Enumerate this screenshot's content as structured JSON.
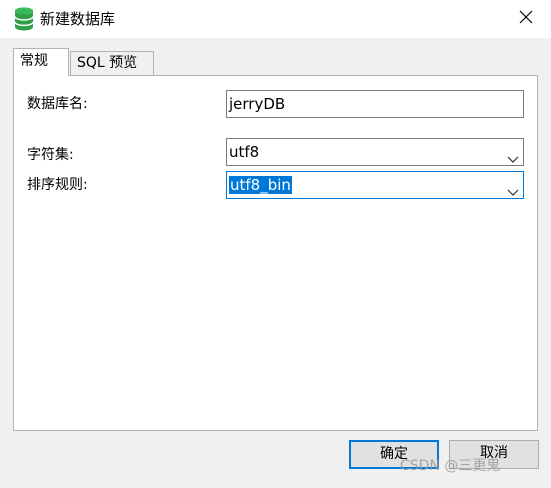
{
  "window": {
    "title": "新建数据库",
    "icon": "database-icon",
    "close_icon": "close-icon"
  },
  "tabs": [
    {
      "label": "常规",
      "active": true
    },
    {
      "label": "SQL 预览",
      "active": false
    }
  ],
  "form": {
    "db_name_label": "数据库名:",
    "db_name_value": "jerryDB",
    "charset_label": "字符集:",
    "charset_value": "utf8",
    "collation_label": "排序规则:",
    "collation_value": "utf8_bin"
  },
  "buttons": {
    "ok": "确定",
    "cancel": "取消"
  },
  "watermark": "CSDN @三更鬼",
  "colors": {
    "accent": "#0078d7",
    "db_icon": "#2e9e47"
  }
}
